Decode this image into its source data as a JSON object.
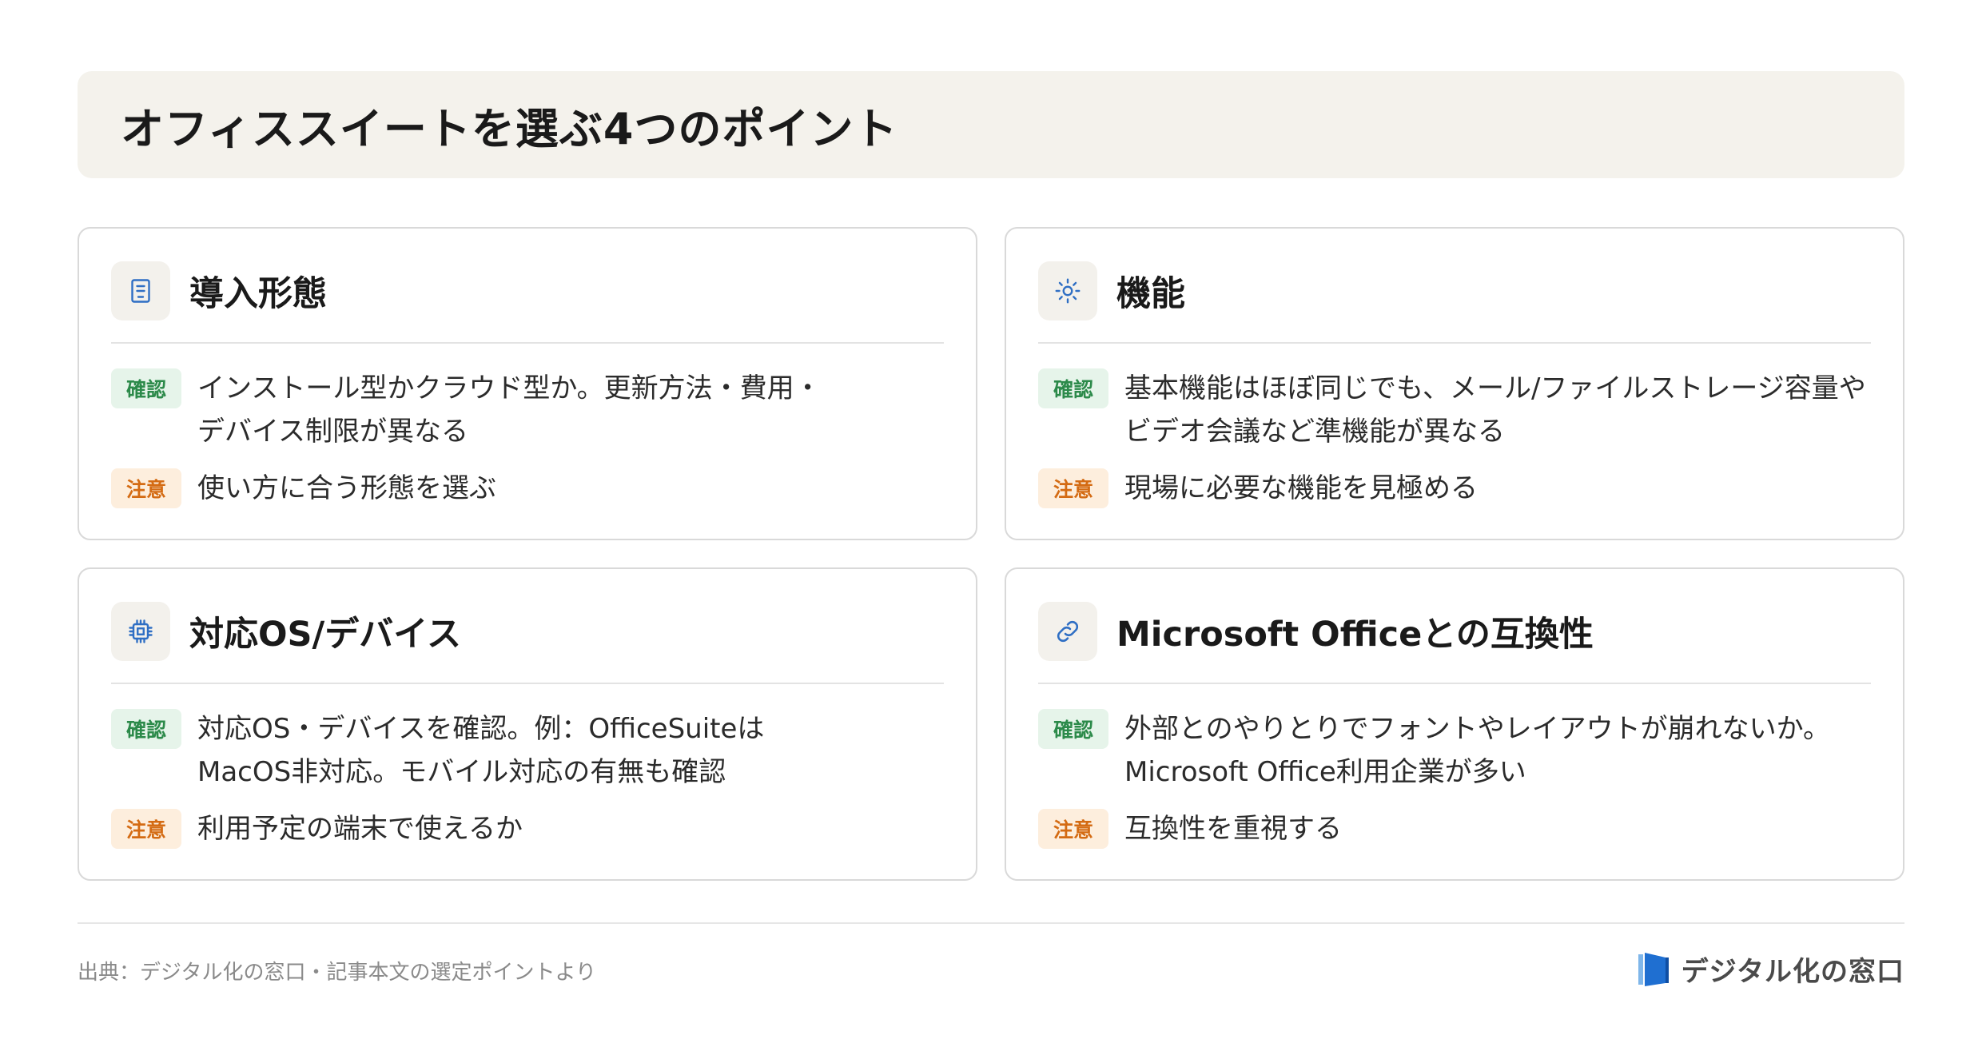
{
  "title": "オフィススイートを選ぶ4つのポイント",
  "cards": [
    {
      "icon": "building-icon",
      "title": "導入形態",
      "check_label": "確認",
      "check_text": "インストール型かクラウド型か。更新方法・費用・\nデバイス制限が異なる",
      "note_label": "注意",
      "note_text": "使い方に合う形態を選ぶ"
    },
    {
      "icon": "sun-gear-icon",
      "title": "機能",
      "check_label": "確認",
      "check_text": "基本機能はほぼ同じでも、メール/ファイルストレージ容量や\nビデオ会議など準機能が異なる",
      "note_label": "注意",
      "note_text": "現場に必要な機能を見極める"
    },
    {
      "icon": "cpu-chip-icon",
      "title": "対応OS/デバイス",
      "check_label": "確認",
      "check_text": "対応OS・デバイスを確認。例：OfficeSuiteは\nMacOS非対応。モバイル対応の有無も確認",
      "note_label": "注意",
      "note_text": "利用予定の端末で使えるか"
    },
    {
      "icon": "link-icon",
      "title": "Microsoft Officeとの互換性",
      "check_label": "確認",
      "check_text": "外部とのやりとりでフォントやレイアウトが崩れないか。\nMicrosoft Office利用企業が多い",
      "note_label": "注意",
      "note_text": "互換性を重視する"
    }
  ],
  "footer": {
    "source": "出典：デジタル化の窓口・記事本文の選定ポイントより",
    "logo_text": "デジタル化の窓口"
  },
  "colors": {
    "icon_blue": "#2f6fc4",
    "check_green": "#2c8a4a",
    "note_orange": "#d46b13"
  }
}
